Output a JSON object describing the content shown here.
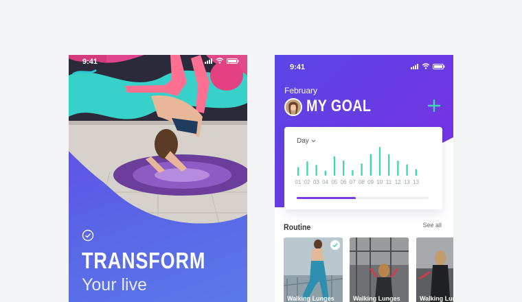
{
  "onboarding": {
    "time": "9:41",
    "headline": "TRANSFORM",
    "subline": "Your live"
  },
  "goal": {
    "time": "9:41",
    "month": "February",
    "title": "MY GOAL",
    "range_label": "Day",
    "progress": 0.45,
    "accent_color": "#3fd6b5",
    "header_colors": [
      "#5a47e6",
      "#7a2fe0"
    ]
  },
  "chart_data": {
    "type": "bar",
    "categories": [
      "01",
      "02",
      "03",
      "04",
      "05",
      "06",
      "07",
      "08",
      "09",
      "10",
      "11",
      "12",
      "13",
      "13"
    ],
    "values": [
      12,
      20,
      15,
      7,
      27,
      21,
      8,
      17,
      30,
      40,
      30,
      21,
      16,
      9
    ],
    "ylim": [
      0,
      40
    ]
  },
  "routine": {
    "title": "Routine",
    "see_all": "See all",
    "cards": [
      {
        "label": "Walking Lunges",
        "completed": true
      },
      {
        "label": "Walking Lunges",
        "completed": false
      },
      {
        "label": "Walking Lunges",
        "completed": false
      }
    ]
  }
}
